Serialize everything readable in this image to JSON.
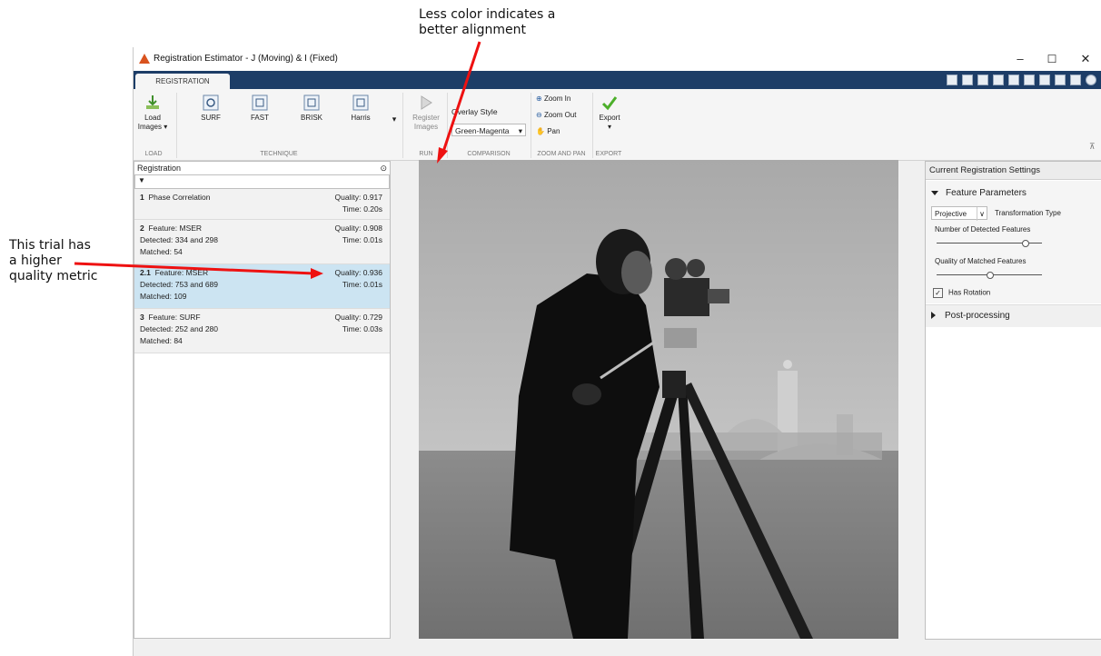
{
  "annotations": {
    "top_line1": "Less color indicates a",
    "top_line2": "better alignment",
    "left_line1": "This trial has",
    "left_line2": "a higher",
    "left_line3": "quality metric"
  },
  "window": {
    "title": "Registration Estimator - J (Moving)  &  I (Fixed)",
    "minimize": "–",
    "maximize": "☐",
    "close": "✕",
    "tab": "REGISTRATION"
  },
  "toolstrip": {
    "load_images": "Load\nImages ▾",
    "techniques": [
      "SURF",
      "FAST",
      "BRISK",
      "Harris"
    ],
    "register_images": "Register\nImages",
    "overlay_style_label": "Overlay Style",
    "overlay_style_value": "Green-Magenta",
    "zoom_in": "Zoom In",
    "zoom_out": "Zoom Out",
    "pan": "Pan",
    "export": "Export",
    "sections": [
      "LOAD",
      "TECHNIQUE",
      "RUN",
      "COMPARISON",
      "ZOOM AND PAN",
      "EXPORT"
    ]
  },
  "registration_panel": {
    "title": "Registration",
    "trials": [
      {
        "id": "1",
        "name": "Phase Correlation",
        "quality": "Quality: 0.917",
        "time": "Time: 0.20s",
        "detected": "",
        "matched": ""
      },
      {
        "id": "2",
        "name": "Feature: MSER",
        "quality": "Quality: 0.908",
        "time": "Time: 0.01s",
        "detected": "Detected: 334 and 298",
        "matched": "Matched: 54"
      },
      {
        "id": "2.1",
        "name": "Feature: MSER",
        "quality": "Quality: 0.936",
        "time": "Time: 0.01s",
        "detected": "Detected: 753 and 689",
        "matched": "Matched: 109"
      },
      {
        "id": "3",
        "name": "Feature: SURF",
        "quality": "Quality: 0.729",
        "time": "Time: 0.03s",
        "detected": "Detected: 252 and 280",
        "matched": "Matched: 84"
      }
    ]
  },
  "settings_panel": {
    "title": "Current Registration Settings",
    "feature_parameters": "Feature Parameters",
    "transformation_value": "Projective",
    "transformation_label": "Transformation Type",
    "num_detected_label": "Number of Detected Features",
    "num_detected_level": 0.85,
    "quality_matched_label": "Quality of Matched Features",
    "quality_matched_level": 0.5,
    "has_rotation": "Has Rotation",
    "post_processing": "Post-processing"
  }
}
